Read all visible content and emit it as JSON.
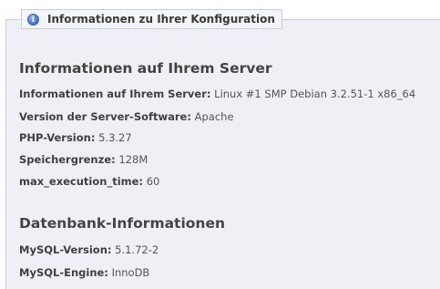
{
  "legend": {
    "icon": "info-icon",
    "icon_glyph": "i",
    "title": "Informationen zu Ihrer Konfiguration"
  },
  "server_section": {
    "heading": "Informationen auf Ihrem Server",
    "rows": [
      {
        "label": "Informationen auf Ihrem Server:",
        "value": "Linux #1 SMP Debian 3.2.51-1 x86_64"
      },
      {
        "label": "Version der Server-Software:",
        "value": "Apache"
      },
      {
        "label": "PHP-Version:",
        "value": "5.3.27"
      },
      {
        "label": "Speichergrenze:",
        "value": "128M"
      },
      {
        "label": "max_execution_time:",
        "value": "60"
      }
    ]
  },
  "database_section": {
    "heading": "Datenbank-Informationen",
    "rows": [
      {
        "label": "MySQL-Version:",
        "value": "5.1.72-2"
      },
      {
        "label": "MySQL-Engine:",
        "value": "InnoDB"
      }
    ]
  },
  "colors": {
    "panel_background": "#eef0f6",
    "panel_border": "#c9cfdd",
    "icon_blue": "#4f7fd0"
  }
}
